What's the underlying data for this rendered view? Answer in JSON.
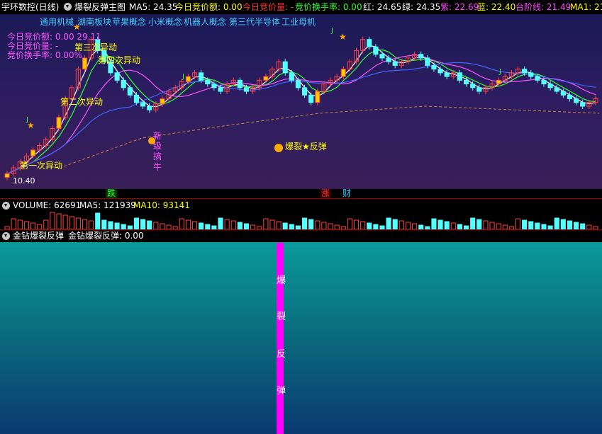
{
  "window": {
    "title": "宇环数控(日线)",
    "main_indicator": "爆裂反弹主图",
    "ma5": "MA5: 24.35",
    "auction_amount": "今日竞价额: 0.00",
    "auction_volume": "今日竞价量: -",
    "auction_turnover": "竞价换手率: 0.00",
    "red": "红: 24.65",
    "green": "绿: 24.35",
    "purple": "紫: 22.69",
    "blue": "蓝: 22.40",
    "step_line": "台阶线: 21.49",
    "ma1": "MA1: 21"
  },
  "concepts": [
    "通用机械",
    "湖南板块",
    "苹果概念",
    "小米概念",
    "机器人概念",
    "第三代半导体",
    "工业母机"
  ],
  "overlay_info": {
    "line1": "今日竞价额: 0.00 29.11",
    "line2": "今日竞价量: -",
    "line3": "竞价换手率: 0.00%"
  },
  "annotations": {
    "first_move": "第一次异动",
    "second_move": "第二次异动",
    "third_move": "第三次异动",
    "fourth_move": "第四次异动",
    "rebound": "爆裂★反弹",
    "low_price": "10.40",
    "new_tag": "新",
    "cow_chars": [
      "级",
      "搞",
      "牛"
    ],
    "j_mark": "J"
  },
  "bottom_tags": {
    "fall": "跌",
    "rise": "涨",
    "wealth": "财"
  },
  "volume": {
    "label": "VOLUME: 62691",
    "ma5": "MA5: 121939",
    "ma10": "MA10: 93141"
  },
  "indicator": {
    "name": "金钻爆裂反弹",
    "value_label": "金钻爆裂反弹: 0.00",
    "bar_chars": [
      "爆",
      "裂",
      "反",
      "弹"
    ]
  },
  "colors": {
    "label_white": "#ffffff",
    "yellow": "#ffff00",
    "magenta": "#ff55ff",
    "green": "#33ff33",
    "red": "#ff3333",
    "cyan": "#44ccff"
  },
  "chart_data": {
    "type": "candlestick",
    "note": "price, approx from visual",
    "closes": [
      10.4,
      11.2,
      12.0,
      12.8,
      13.6,
      14.2,
      15.0,
      16.5,
      18.0,
      20.5,
      22.0,
      24.5,
      26.0,
      28.5,
      27.0,
      25.5,
      24.0,
      23.0,
      22.0,
      21.0,
      20.0,
      19.5,
      19.0,
      19.8,
      20.5,
      21.5,
      22.0,
      22.8,
      23.5,
      24.0,
      23.0,
      22.5,
      22.0,
      21.5,
      22.5,
      23.0,
      22.0,
      21.5,
      22.0,
      23.0,
      23.5,
      24.5,
      25.5,
      24.0,
      23.0,
      22.0,
      21.0,
      20.0,
      21.5,
      22.5,
      23.0,
      23.5,
      24.5,
      25.5,
      27.0,
      28.5,
      27.5,
      26.5,
      26.0,
      25.5,
      25.0,
      25.5,
      26.0,
      26.5,
      26.0,
      25.0,
      24.5,
      24.0,
      23.5,
      24.0,
      23.0,
      22.5,
      22.0,
      21.5,
      22.0,
      22.5,
      23.0,
      23.5,
      24.0,
      24.5,
      24.0,
      23.5,
      23.0,
      22.5,
      22.0,
      21.5,
      21.0,
      20.5,
      20.0,
      19.5,
      20.0,
      20.5
    ]
  }
}
